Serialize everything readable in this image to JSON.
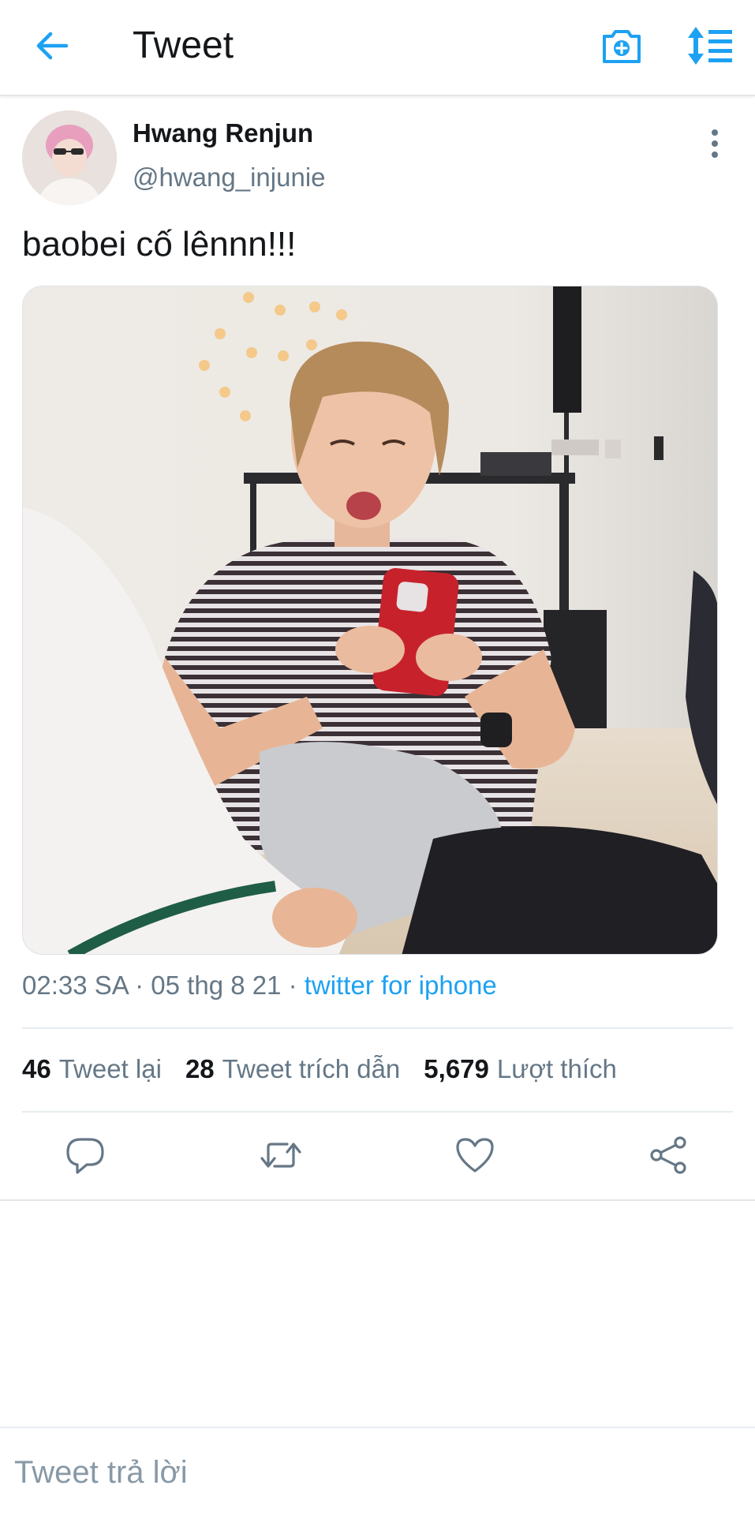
{
  "header": {
    "title": "Tweet",
    "back_icon": "arrow-left-icon",
    "camera_icon": "camera-plus-icon",
    "sort_icon": "sort-list-icon"
  },
  "tweet": {
    "display_name": "Hwang Renjun",
    "username": "@hwang_injunie",
    "text": "baobei cố lênnn!!!",
    "time": "02:33 SA",
    "date": "05 thg 8 21",
    "separator": "·",
    "source": "twitter for iphone",
    "media_alt": "photo"
  },
  "stats": {
    "retweets_count": "46",
    "retweets_label": "Tweet lại",
    "quotes_count": "28",
    "quotes_label": "Tweet trích dẫn",
    "likes_count": "5,679",
    "likes_label": "Lượt thích"
  },
  "reply": {
    "placeholder": "Tweet trả lời"
  },
  "colors": {
    "accent": "#1da1f2",
    "text": "#14171a",
    "secondary": "#657786"
  }
}
